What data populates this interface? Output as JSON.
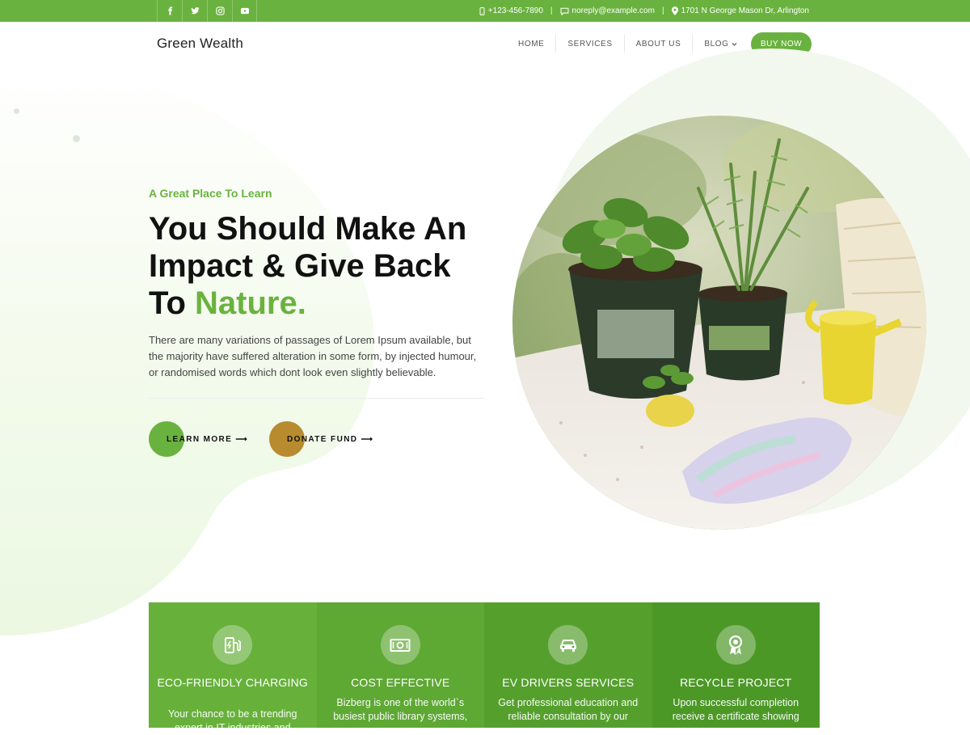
{
  "topbar": {
    "social_icons": [
      "facebook-icon",
      "twitter-icon",
      "instagram-icon",
      "youtube-icon"
    ],
    "phone": "+123-456-7890",
    "email": "noreply@example.com",
    "address": "1701 N George Mason Dr, Arlington",
    "separator": "|"
  },
  "header": {
    "logo": "Green Wealth",
    "nav": [
      "HOME",
      "SERVICES",
      "ABOUT US",
      "BLOG"
    ],
    "buy_label": "BUY NOW"
  },
  "hero": {
    "eyebrow": "A Great Place To Learn",
    "headline_line1": "You Should Make An",
    "headline_line2": "Impact & Give Back",
    "headline_line3_prefix": "To ",
    "headline_accent": "Nature.",
    "paragraph": "There are many variations of passages of Lorem Ipsum available, but the majority have suffered alteration in some form, by injected humour, or randomised words which dont look even slightly believable.",
    "btn_learn": "LEARN MORE",
    "btn_donate": "DONATE FUND",
    "arrow": "⟶"
  },
  "features": [
    {
      "icon": "ev-charging-icon",
      "title": "ECO-FRIENDLY CHARGING",
      "desc": "Your chance to be a trending expert in IT industries and"
    },
    {
      "icon": "money-icon",
      "title": "COST EFFECTIVE",
      "desc": "Bizberg is one of the world`s busiest public library systems,"
    },
    {
      "icon": "car-icon",
      "title": "EV DRIVERS SERVICES",
      "desc": "Get professional education and reliable consultation by our"
    },
    {
      "icon": "award-icon",
      "title": "RECYCLE PROJECT",
      "desc": "Upon successful completion receive a certificate showing"
    }
  ],
  "colors": {
    "brand_green": "#6ab23f",
    "donate_gold": "#b88b2f",
    "feature_bg": [
      "#67b13b",
      "#5ea834",
      "#55a02d",
      "#4c9827"
    ]
  }
}
